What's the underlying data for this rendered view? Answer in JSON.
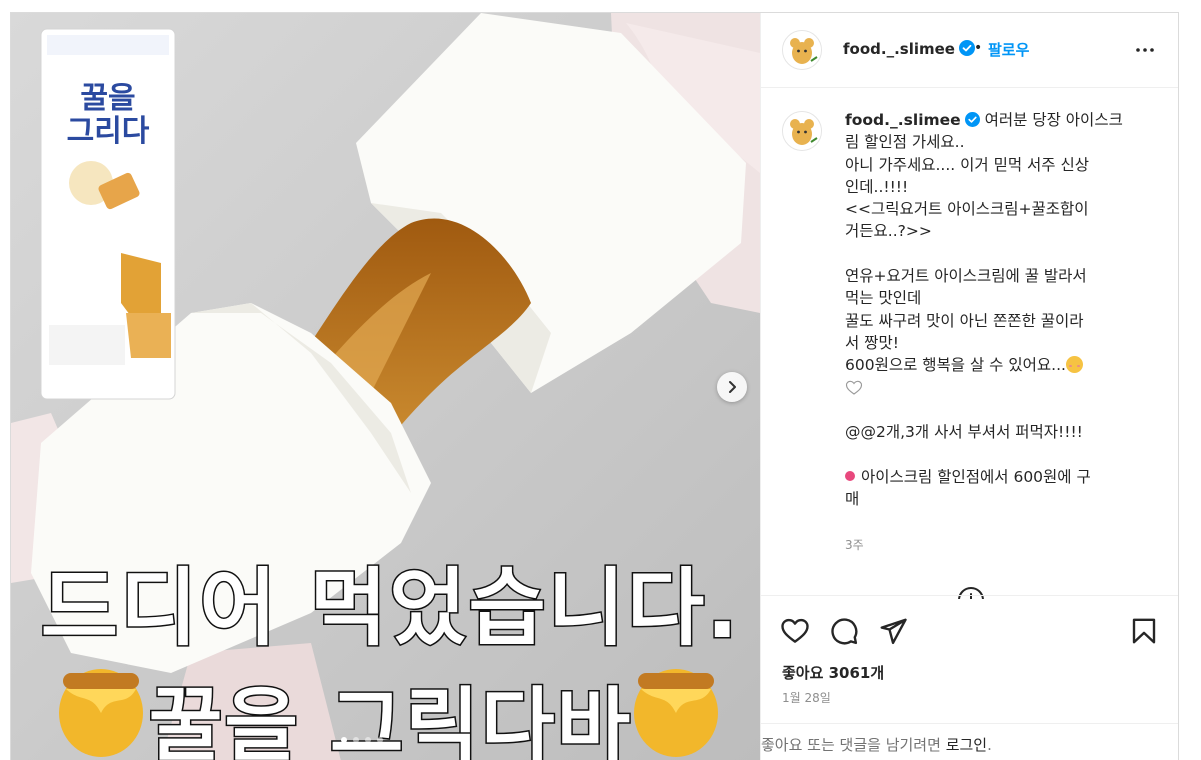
{
  "post": {
    "username": "food._.slimee",
    "follow_label": "팔로우",
    "bullet": "•",
    "media": {
      "caption_line1": "드디어 먹었습니다.",
      "caption_line2": "꿀을 그릭다바",
      "carousel_dots": 4,
      "active_dot": 0
    },
    "caption": {
      "username": "food._.slimee",
      "lines": [
        "여러분 당장 아이스크",
        "림 할인점 가세요..",
        "아니 가주세요.... 이거 믿먹 서주 신상",
        "인데..!!!!",
        "<<그릭요거트 아이스크림+꿀조합이",
        "거든요..?>>",
        "",
        "연유+요거트 아이스크림에 꿀 발라서",
        "먹는 맛인데",
        "꿀도 싸구려 맛이 아닌 쫀쫀한 꿀이라",
        "서 짱맛!",
        "600원으로 행복을 살 수 있어요...",
        "",
        "",
        "@@2개,3개 사서 부셔서 퍼먹자!!!!",
        "",
        "아이스크림 할인점에서 600원에 구",
        "매"
      ],
      "time": "3주"
    },
    "likes_label": "좋아요 3061개",
    "date": "1월 28일",
    "login_prompt_prefix": "좋아요 또는 댓글을 남기려면 ",
    "login_link": "로그인",
    "login_prompt_suffix": "."
  },
  "colors": {
    "link_blue": "#0095f6",
    "verified_blue": "#0095f6",
    "text": "#262626",
    "muted": "#8e8e8e",
    "border": "#dbdbdb"
  },
  "icons": {
    "more": "more-horizontal-icon",
    "next": "chevron-right-icon",
    "like": "heart-icon",
    "comment": "comment-icon",
    "share": "send-icon",
    "save": "bookmark-icon",
    "load_more": "plus-circle-icon"
  }
}
